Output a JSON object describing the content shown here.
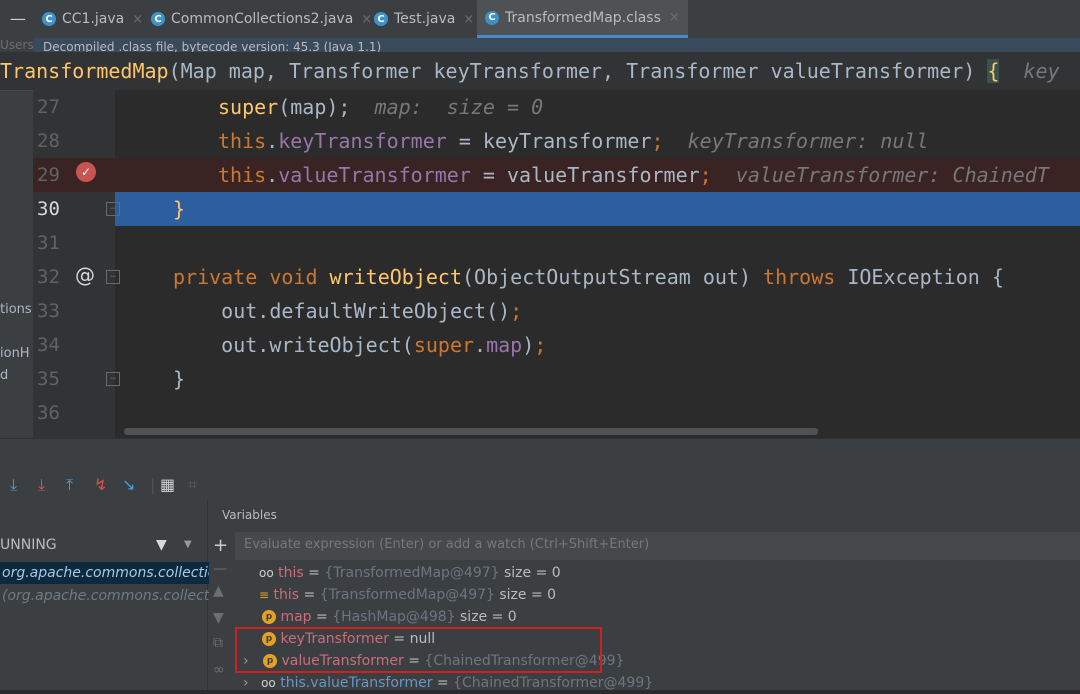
{
  "tabs": [
    {
      "label": "CC1.java",
      "close": "×"
    },
    {
      "label": "CommonCollections2.java",
      "close": "×"
    },
    {
      "label": "Test.java",
      "close": "×"
    },
    {
      "label": "TransformedMap.class",
      "close": "×"
    }
  ],
  "banner": {
    "text": "Decompiled .class file, bytecode version: 45.3 (Java 1.1)",
    "user_fragment": "Users"
  },
  "sticky": {
    "name": "TransformedMap",
    "params": "(Map map, Transformer keyTransformer, Transformer valueTransformer) ",
    "brace": "{",
    "hint": "key"
  },
  "editor": {
    "lines": [
      {
        "num": "27",
        "parts": [
          [
            "fn",
            "super"
          ],
          [
            "txt",
            "(map);  "
          ],
          [
            "hint",
            "map:  size = 0"
          ]
        ]
      },
      {
        "num": "28",
        "parts": [
          [
            "kw",
            "this"
          ],
          [
            "txt",
            "."
          ],
          [
            "fld",
            "keyTransformer"
          ],
          [
            "txt",
            " = keyTransformer"
          ],
          [
            "kw",
            ";"
          ],
          [
            "txt",
            "  "
          ],
          [
            "hint",
            "keyTransformer: null"
          ]
        ]
      },
      {
        "num": "29",
        "parts": [
          [
            "kw",
            "this"
          ],
          [
            "txt",
            "."
          ],
          [
            "fld",
            "valueTransformer"
          ],
          [
            "txt",
            " = valueTransformer"
          ],
          [
            "kw",
            ";"
          ],
          [
            "txt",
            "  "
          ],
          [
            "hint",
            "valueTransformer: ChainedT"
          ]
        ]
      },
      {
        "num": "30",
        "parts": [
          [
            "fn",
            "}"
          ]
        ]
      },
      {
        "num": "31",
        "parts": []
      },
      {
        "num": "32",
        "parts": [
          [
            "kw",
            "private void "
          ],
          [
            "fn",
            "writeObject"
          ],
          [
            "txt",
            "(ObjectOutputStream out) "
          ],
          [
            "kw",
            "throws "
          ],
          [
            "txt",
            "IOException {"
          ]
        ]
      },
      {
        "num": "33",
        "parts": [
          [
            "txt",
            "    out.defaultWriteObject()"
          ],
          [
            "kw",
            ";"
          ]
        ]
      },
      {
        "num": "34",
        "parts": [
          [
            "txt",
            "    out.writeObject("
          ],
          [
            "kw",
            "super"
          ],
          [
            "txt",
            "."
          ],
          [
            "fld",
            "map"
          ],
          [
            "txt",
            ")"
          ],
          [
            "kw",
            ";"
          ]
        ]
      },
      {
        "num": "35",
        "parts": [
          [
            "txt",
            "}"
          ]
        ]
      },
      {
        "num": "36",
        "parts": []
      }
    ],
    "left_fragments": [
      "tions.",
      "ionH",
      "d"
    ]
  },
  "debugger": {
    "thread_label": "UNNING",
    "frames": [
      "org.apache.commons.collections.",
      "(org.apache.commons.collection"
    ],
    "variables_title": "Variables",
    "eval_placeholder": "Evaluate expression (Enter) or add a watch (Ctrl+Shift+Enter)",
    "variables": [
      {
        "icon": "oo",
        "name": "this",
        "eq": " = ",
        "obj": "{TransformedMap@497}",
        "extra": "  size = 0",
        "kind": "this"
      },
      {
        "icon": "≡",
        "name": "this",
        "eq": " = ",
        "obj": "{TransformedMap@497}",
        "extra": "  size = 0",
        "kind": "field"
      },
      {
        "icon": "p",
        "name": "map",
        "eq": " = ",
        "obj": "{HashMap@498}",
        "extra": "  size = 0",
        "kind": "param"
      },
      {
        "icon": "p",
        "name": "keyTransformer",
        "eq": " = ",
        "obj": "",
        "extra": "null",
        "kind": "param"
      },
      {
        "icon": "p",
        "name": "valueTransformer",
        "eq": " = ",
        "obj": "{ChainedTransformer@499}",
        "extra": "",
        "kind": "param",
        "expand": "›"
      },
      {
        "icon": "oo",
        "name": "this.valueTransformer",
        "eq": " = ",
        "obj": "{ChainedTransformer@499}",
        "extra": "",
        "kind": "watch",
        "expand": "›"
      }
    ]
  }
}
